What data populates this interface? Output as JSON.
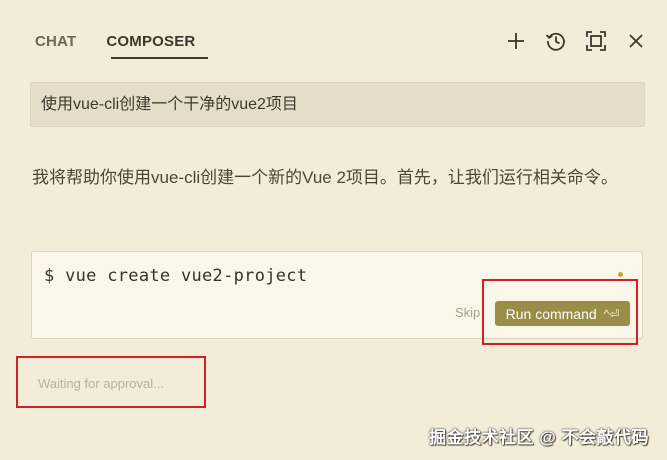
{
  "tabs": [
    {
      "label": "CHAT",
      "active": false
    },
    {
      "label": "COMPOSER",
      "active": true
    }
  ],
  "header_icons": [
    "plus-icon",
    "history-icon",
    "maximize-icon",
    "close-icon"
  ],
  "user_message": "使用vue-cli创建一个干净的vue2项目",
  "assistant_message": "我将帮助你使用vue-cli创建一个新的Vue 2项目。首先，让我们运行相关命令。",
  "command": {
    "text": "$ vue create vue2-project",
    "skip_label": "Skip",
    "run_label": "Run command",
    "run_shortcut": "^⏎"
  },
  "waiting_text": "Waiting for approval...",
  "watermark": "掘金技术社区 @ 不会敲代码",
  "colors": {
    "background": "#f2ecd9",
    "accent": "#9b8c47",
    "highlight": "#d0202a",
    "status_dot": "#c9a630"
  }
}
